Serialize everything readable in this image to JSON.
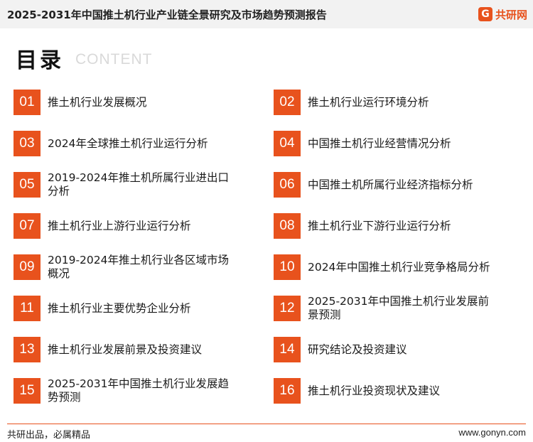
{
  "header": {
    "title": "2025-2031年中国推土机行业产业链全景研究及市场趋势预测报告",
    "logo_mark": "G",
    "logo_text": "共研网"
  },
  "heading": {
    "cn": "目录",
    "en": "CONTENT"
  },
  "items": [
    {
      "num": "01",
      "label": "推土机行业发展概况"
    },
    {
      "num": "02",
      "label": "推土机行业运行环境分析"
    },
    {
      "num": "03",
      "label": "2024年全球推土机行业运行分析"
    },
    {
      "num": "04",
      "label": "中国推土机行业经营情况分析"
    },
    {
      "num": "05",
      "label": "2019-2024年推土机所属行业进出口分析"
    },
    {
      "num": "06",
      "label": "中国推土机所属行业经济指标分析"
    },
    {
      "num": "07",
      "label": "推土机行业上游行业运行分析"
    },
    {
      "num": "08",
      "label": "推土机行业下游行业运行分析"
    },
    {
      "num": "09",
      "label": "2019-2024年推土机行业各区域市场概况"
    },
    {
      "num": "10",
      "label": "2024年中国推土机行业竞争格局分析"
    },
    {
      "num": "11",
      "label": "推土机行业主要优势企业分析"
    },
    {
      "num": "12",
      "label": "2025-2031年中国推土机行业发展前景预测"
    },
    {
      "num": "13",
      "label": "推土机行业发展前景及投资建议"
    },
    {
      "num": "14",
      "label": "研究结论及投资建议"
    },
    {
      "num": "15",
      "label": "2025-2031年中国推土机行业发展趋势预测"
    },
    {
      "num": "16",
      "label": "推土机行业投资现状及建议"
    }
  ],
  "footer": {
    "left": "共研出品，必属精品",
    "right": "www.gonyn.com"
  },
  "colors": {
    "accent": "#e8521d"
  }
}
